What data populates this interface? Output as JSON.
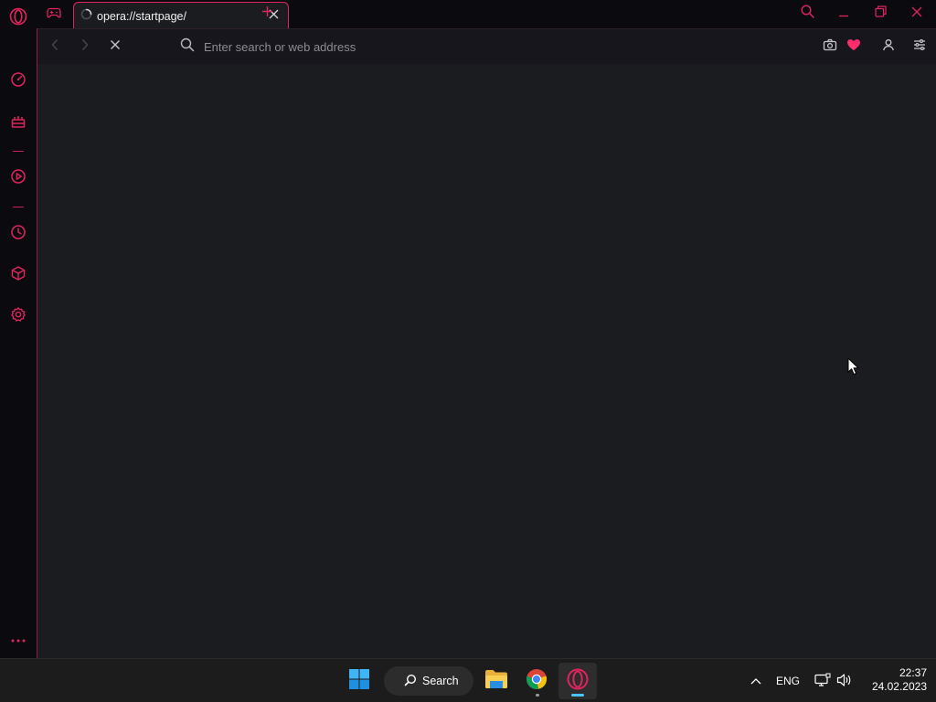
{
  "colors": {
    "accent": "#e0245e",
    "content_bg": "#1b1c1f",
    "sidebar_bg": "#0b0a0e",
    "taskbar_bg": "#1c1c1c",
    "win_blue": "#4cc2ff"
  },
  "sidebar": {
    "items": [
      {
        "icon": "opera-logo-icon"
      },
      {
        "icon": "speed-dial-icon"
      },
      {
        "icon": "gx-corner-icon"
      },
      {
        "icon": "player-icon"
      },
      {
        "icon": "history-icon"
      },
      {
        "icon": "extensions-cube-icon"
      },
      {
        "icon": "settings-gear-icon"
      },
      {
        "icon": "more-dots-icon"
      }
    ]
  },
  "tabs": [
    {
      "title": "opera://startpage/",
      "state": "loading",
      "active": true
    }
  ],
  "toolbar": {
    "address_placeholder": "Enter search or web address",
    "address_value": ""
  },
  "taskbar": {
    "search_label": "Search",
    "apps": [
      {
        "name": "File Explorer",
        "icon": "folder-icon"
      },
      {
        "name": "Google Chrome",
        "icon": "chrome-icon"
      },
      {
        "name": "Opera GX",
        "icon": "opera-gx-icon",
        "active": true
      }
    ],
    "language": "ENG",
    "time": "22:37",
    "date": "24.02.2023"
  }
}
